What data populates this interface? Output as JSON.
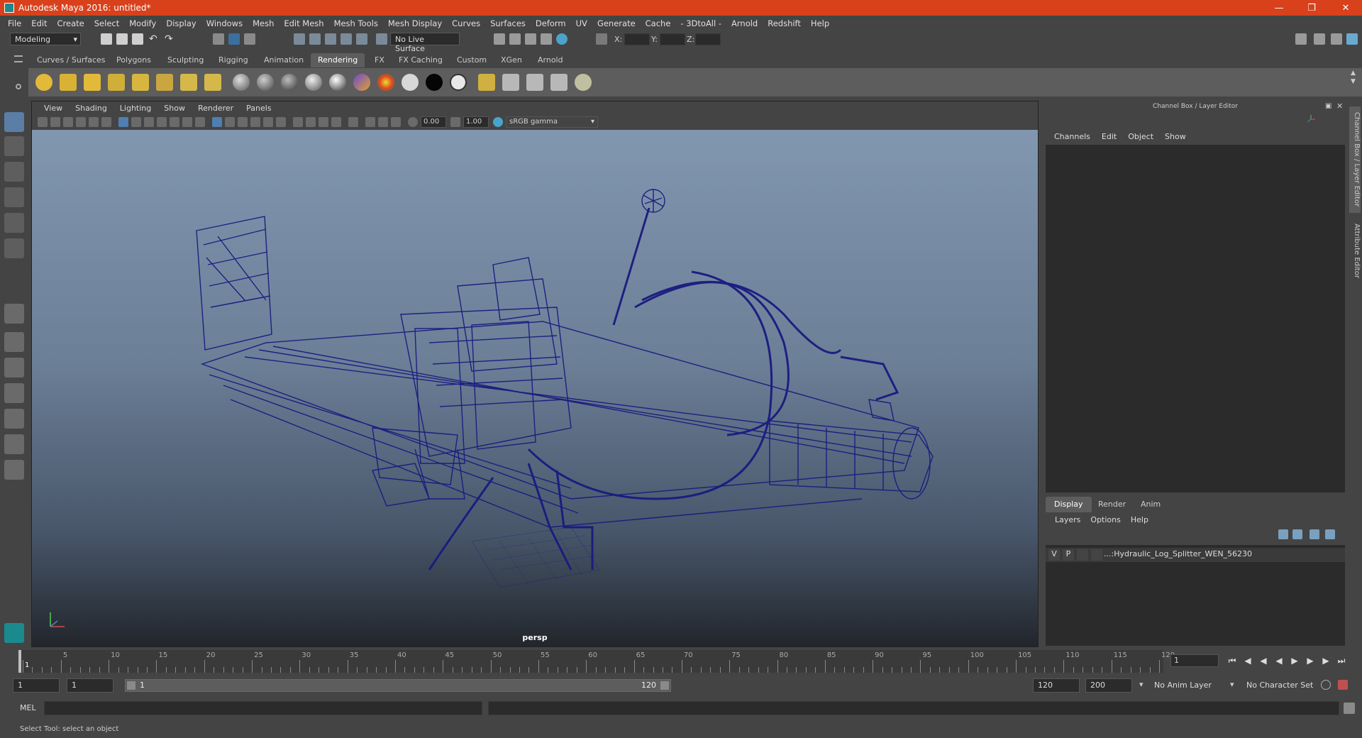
{
  "window": {
    "title": "Autodesk Maya 2016: untitled*"
  },
  "menus": [
    "File",
    "Edit",
    "Create",
    "Select",
    "Modify",
    "Display",
    "Windows",
    "Mesh",
    "Edit Mesh",
    "Mesh Tools",
    "Mesh Display",
    "Curves",
    "Surfaces",
    "Deform",
    "UV",
    "Generate",
    "Cache",
    "- 3DtoAll -",
    "Arnold",
    "Redshift",
    "Help"
  ],
  "status": {
    "mode": "Modeling",
    "live_surface": "No Live Surface",
    "x_label": "X:",
    "y_label": "Y:",
    "z_label": "Z:"
  },
  "shelf_tabs": [
    "Curves / Surfaces",
    "Polygons",
    "Sculpting",
    "Rigging",
    "Animation",
    "Rendering",
    "FX",
    "FX Caching",
    "Custom",
    "XGen",
    "Arnold"
  ],
  "active_shelf": "Rendering",
  "viewport": {
    "menus": [
      "View",
      "Shading",
      "Lighting",
      "Show",
      "Renderer",
      "Panels"
    ],
    "exposure": "0.00",
    "gamma": "1.00",
    "color_space": "sRGB gamma",
    "camera": "persp"
  },
  "channel_box": {
    "title": "Channel Box / Layer Editor",
    "menus": [
      "Channels",
      "Edit",
      "Object",
      "Show"
    ]
  },
  "layer_editor": {
    "tabs": [
      "Display",
      "Render",
      "Anim"
    ],
    "active_tab": "Display",
    "menus": [
      "Layers",
      "Options",
      "Help"
    ],
    "layer": {
      "v": "V",
      "p": "P",
      "name": "...:Hydraulic_Log_Splitter_WEN_56230"
    }
  },
  "side_tabs": [
    "Channel Box / Layer Editor",
    "Attribute Editor"
  ],
  "timeline": {
    "labels": [
      "1",
      "5",
      "10",
      "15",
      "20",
      "25",
      "30",
      "35",
      "40",
      "45",
      "50",
      "55",
      "60",
      "65",
      "70",
      "75",
      "80",
      "85",
      "90",
      "95",
      "100",
      "105",
      "110",
      "115",
      "120"
    ],
    "current_frame": "1"
  },
  "range": {
    "start": "1",
    "playback_start": "1",
    "slider_start": "1",
    "slider_end": "120",
    "playback_end": "120",
    "end": "200",
    "anim_layer": "No Anim Layer",
    "character_set": "No Character Set"
  },
  "command": {
    "label": "MEL"
  },
  "help_line": "Select Tool: select an object",
  "colors": {
    "title_bar": "#d8411c",
    "wireframe": "#1a1a80"
  }
}
